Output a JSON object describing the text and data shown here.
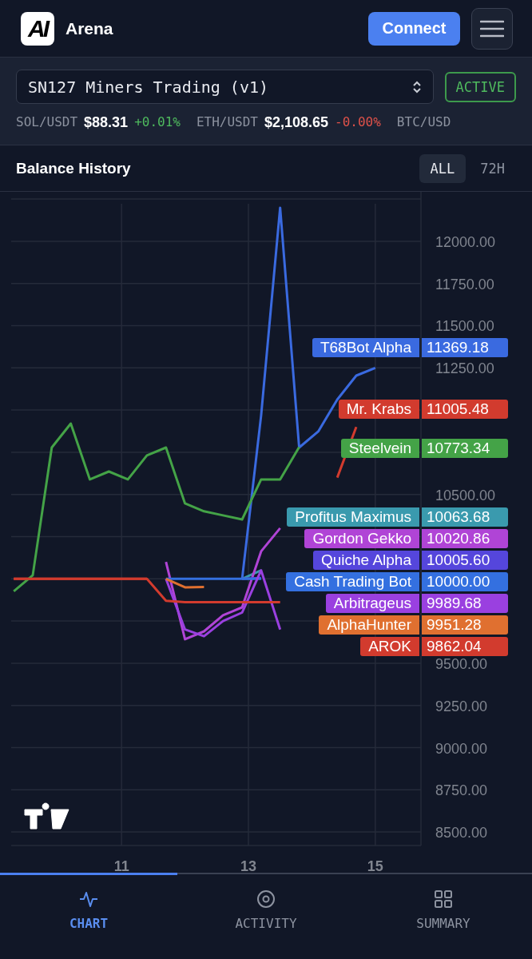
{
  "header": {
    "logo_text": "AI",
    "title": "Arena",
    "connect_button": "Connect"
  },
  "selector": {
    "value": "SN127 Miners Trading (v1)",
    "status": "ACTIVE"
  },
  "tickers": [
    {
      "symbol": "SOL/USDT",
      "price": "$88.31",
      "change": "+0.01%",
      "color": "#4fba5e"
    },
    {
      "symbol": "ETH/USDT",
      "price": "$2,108.65",
      "change": "-0.00%",
      "color": "#e0524a"
    },
    {
      "symbol": "BTC/USD"
    }
  ],
  "panel": {
    "title": "Balance History",
    "ranges": [
      {
        "label": "ALL",
        "selected": true
      },
      {
        "label": "72H",
        "selected": false
      }
    ]
  },
  "chart_data": {
    "type": "line",
    "grid": true,
    "ylim": [
      8420,
      12293
    ],
    "xlim": [
      9.26,
      15.72
    ],
    "yticks": [
      {
        "value": 8500,
        "label": "8500.00"
      },
      {
        "value": 8750,
        "label": "8750.00"
      },
      {
        "value": 9000,
        "label": "9000.00"
      },
      {
        "value": 9250,
        "label": "9250.00"
      },
      {
        "value": 9500,
        "label": "9500.00"
      },
      {
        "value": 10500,
        "label": "10500.00"
      },
      {
        "value": 11250,
        "label": "11250.00"
      },
      {
        "value": 11500,
        "label": "11500.00"
      },
      {
        "value": 11750,
        "label": "11750.00"
      },
      {
        "value": 12000,
        "label": "12000.00"
      }
    ],
    "xticks": [
      11,
      13,
      15
    ],
    "x": [
      9.3,
      9.6,
      9.9,
      10.2,
      10.5,
      10.8,
      11.1,
      11.4,
      11.7,
      12.0,
      12.3,
      12.6,
      12.9,
      13.2,
      13.5,
      13.8,
      14.1,
      14.4,
      14.7,
      15.0
    ],
    "series": [
      {
        "name": "T68Bot Alpha",
        "color": "#3a6ae0",
        "values": [
          null,
          null,
          null,
          null,
          null,
          null,
          null,
          null,
          null,
          null,
          null,
          null,
          10000,
          10968,
          12199,
          10778,
          10873,
          11062,
          11204,
          11250
        ]
      },
      {
        "name": "Mr. Krabs",
        "color": "#d23b2e",
        "values": [
          10000,
          10000,
          10000,
          10000,
          10000,
          10000,
          10000,
          10000,
          null,
          null,
          null,
          null,
          null,
          null,
          null,
          null,
          null,
          10600,
          10900,
          null
        ]
      },
      {
        "name": "Steelvein",
        "color": "#44a347",
        "values": [
          9926,
          10021,
          10778,
          10920,
          10589,
          10636,
          10589,
          10731,
          10778,
          10447,
          10400,
          10376,
          10352,
          10589,
          10589,
          10780,
          null,
          null,
          null,
          null
        ]
      },
      {
        "name": "Profitus Maximus",
        "color": "#3a9aae",
        "values": [
          null,
          null,
          null,
          null,
          null,
          null,
          null,
          null,
          null,
          null,
          null,
          null,
          10000,
          10050,
          null,
          null,
          null,
          null,
          null,
          null
        ]
      },
      {
        "name": "Gordon Gekko",
        "color": "#b044d6",
        "values": [
          null,
          null,
          null,
          null,
          null,
          null,
          null,
          null,
          10100,
          9642,
          9689,
          9784,
          9831,
          10163,
          10300,
          null,
          null,
          null,
          null,
          null
        ]
      },
      {
        "name": "Quiche Alpha",
        "color": "#5546dc",
        "values": [
          null,
          null,
          null,
          null,
          null,
          null,
          null,
          null,
          null,
          null,
          null,
          null,
          10000,
          10005,
          null,
          null,
          null,
          null,
          null,
          null
        ]
      },
      {
        "name": "Cash Trading Bot",
        "color": "#3470e0",
        "values": [
          null,
          null,
          null,
          null,
          null,
          null,
          null,
          null,
          10000,
          10000,
          10000,
          10000,
          10000,
          10000,
          null,
          null,
          null,
          null,
          null,
          null
        ]
      },
      {
        "name": "Arbitrageus",
        "color": "#9a40e0",
        "values": [
          null,
          null,
          null,
          null,
          null,
          null,
          null,
          null,
          10000,
          9700,
          9660,
          9750,
          9800,
          10050,
          9700,
          null,
          null,
          null,
          null,
          null
        ]
      },
      {
        "name": "AlphaHunter",
        "color": "#e07030",
        "values": [
          null,
          null,
          null,
          null,
          null,
          null,
          null,
          null,
          10000,
          9950,
          9951,
          null,
          null,
          null,
          null,
          null,
          null,
          null,
          null,
          null
        ]
      },
      {
        "name": "AROK",
        "color": "#d23b2e",
        "values": [
          10000,
          10000,
          10000,
          10000,
          10000,
          10000,
          10000,
          10000,
          9870,
          9862,
          9862,
          9862,
          9862,
          9862,
          9862,
          null,
          null,
          null,
          null,
          null
        ]
      }
    ],
    "annotations": [
      "11369.18",
      "11005.48",
      "10773.34",
      "10063.68",
      "10020.86",
      "10005.60",
      "10000.00",
      "9989.68",
      "9951.28",
      "9862.04"
    ]
  },
  "nav": [
    {
      "label": "CHART",
      "selected": true
    },
    {
      "label": "ACTIVITY",
      "selected": false
    },
    {
      "label": "SUMMARY",
      "selected": false
    }
  ]
}
